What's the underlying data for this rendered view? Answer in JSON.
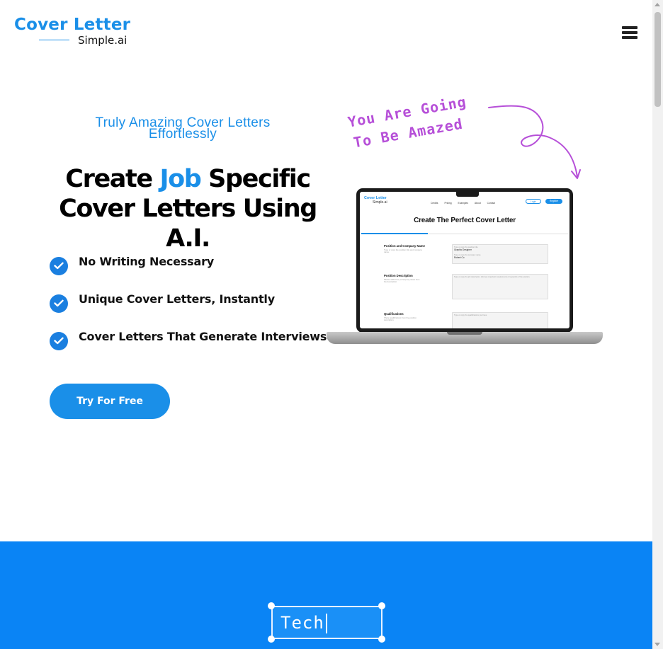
{
  "header": {
    "logo_top": "Cover Letter",
    "logo_bottom": "Simple.ai",
    "menu_icon": "hamburger-menu-icon"
  },
  "hero": {
    "tagline": "Truly Amazing Cover Letters Effortlessly",
    "headline_pre": "Create ",
    "headline_accent": "Job",
    "headline_post": " Specific Cover Letters Using A.I.",
    "features": [
      "No Writing Necessary",
      "Unique Cover Letters, Instantly",
      "Cover Letters That Generate Interviews"
    ],
    "cta_label": "Try For Free"
  },
  "annotation": {
    "line1": "You Are Going",
    "line2": "To Be Amazed"
  },
  "screen": {
    "logo_top": "Cover Letter",
    "logo_bottom": "Simple.ai",
    "nav": [
      "Credits",
      "Pricing",
      "Examples",
      "About",
      "Contact"
    ],
    "login": "Login",
    "register": "Register",
    "title": "Create The Perfect Cover Letter",
    "sections": [
      {
        "title": "Position and Company Name",
        "desc": "Type or copy the position title and company name.",
        "fields": [
          {
            "label": "Type or copy the position title",
            "value": "Graphic Designer"
          },
          {
            "label": "Type or copy the company name",
            "value": "Robert Co"
          }
        ]
      },
      {
        "title": "Position Description",
        "desc": "Please add three (or few) key ideas from the description.",
        "fields": [
          {
            "label": "Type or copy the job description. Add any important requirements or keywords of the position.",
            "value": ""
          }
        ]
      },
      {
        "title": "Qualifications",
        "desc": "Share qualifications from the position description.",
        "fields": [
          {
            "label": "Type or copy the qualifications you have",
            "value": ""
          }
        ]
      }
    ]
  },
  "band": {
    "typing_text": "Tech"
  },
  "colors": {
    "brand_blue": "#1a8fe8",
    "band_blue": "#0a84f5",
    "annotation_purple": "#b64fd8"
  }
}
